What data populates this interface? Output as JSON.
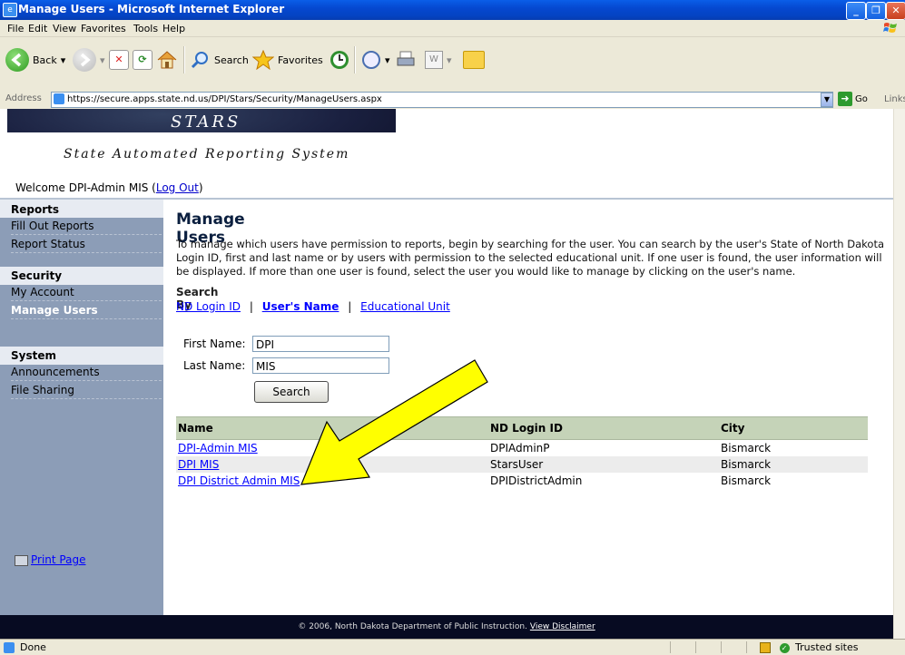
{
  "window": {
    "title": "Manage Users - Microsoft Internet Explorer"
  },
  "menu": [
    "File",
    "Edit",
    "View",
    "Favorites",
    "Tools",
    "Help"
  ],
  "toolbar": {
    "back": "Back",
    "search": "Search",
    "favorites": "Favorites"
  },
  "address": {
    "label": "Address",
    "url": "https://secure.apps.state.nd.us/DPI/Stars/Security/ManageUsers.aspx",
    "go": "Go",
    "links": "Links"
  },
  "banner": {
    "title": "STARS",
    "subtitle": "State Automated Reporting System"
  },
  "welcome": {
    "text": "Welcome DPI-Admin MIS (",
    "logout": "Log Out",
    "close": ")"
  },
  "sidebar": {
    "sections": [
      {
        "title": "Reports",
        "items": [
          "Fill Out Reports",
          "Report Status"
        ]
      },
      {
        "title": "Security",
        "items": [
          "My Account",
          "Manage Users"
        ]
      },
      {
        "title": "System",
        "items": [
          "Announcements",
          "File Sharing"
        ]
      }
    ],
    "active": "Manage Users",
    "print": "Print Page"
  },
  "main": {
    "heading": "Manage Users",
    "intro": "To manage which users have permission to reports, begin by searching for the user. You can search by the user's State of North Dakota Login ID, first and last name or by users with permission to the selected educational unit. If one user is found, the user information will be displayed. If more than one user is found, select the user you would like to manage by clicking on the user's name.",
    "search_by": "Search By",
    "links": [
      "ND Login ID",
      "User's Name",
      "Educational Unit"
    ],
    "link_sep": "|",
    "first_name_label": "First Name:",
    "first_name_value": "DPI",
    "last_name_label": "Last Name:",
    "last_name_value": "MIS",
    "search_button": "Search",
    "table": {
      "headers": [
        "Name",
        "ND Login ID",
        "City"
      ],
      "rows": [
        [
          "DPI-Admin MIS",
          "DPIAdminP",
          "Bismarck"
        ],
        [
          "DPI MIS",
          "StarsUser",
          "Bismarck"
        ],
        [
          "DPI District Admin MIS",
          "DPIDistrictAdmin",
          "Bismarck"
        ]
      ]
    },
    "annotation_arrow_color": "#ffff00"
  },
  "footer": {
    "text": "© 2006, North Dakota Department of Public Instruction.",
    "link": "View Disclaimer"
  },
  "status": {
    "left": "Done",
    "zone": "Trusted sites"
  },
  "colors": {
    "titlebar": "#0548d0",
    "sidebar": "#8c9db7",
    "footer": "#070b22",
    "table_header": "#c5d3b8"
  }
}
